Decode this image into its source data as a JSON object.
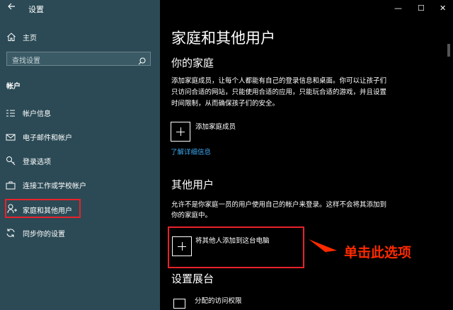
{
  "window": {
    "back_icon": "back-arrow-icon",
    "title": "设置",
    "controls": {
      "minimize": "—",
      "maximize": "☐",
      "close": "✕"
    }
  },
  "sidebar": {
    "home_label": "主页",
    "search_placeholder": "查找设置",
    "section_title": "帐户",
    "items": [
      {
        "label": "帐户信息",
        "icon": "account-info-icon"
      },
      {
        "label": "电子邮件和帐户",
        "icon": "mail-icon"
      },
      {
        "label": "登录选项",
        "icon": "key-icon"
      },
      {
        "label": "连接工作或学校帐户",
        "icon": "briefcase-icon"
      },
      {
        "label": "家庭和其他用户",
        "icon": "family-icon",
        "selected": true
      },
      {
        "label": "同步你的设置",
        "icon": "sync-icon"
      }
    ]
  },
  "main": {
    "page_title": "家庭和其他用户",
    "family": {
      "heading": "你的家庭",
      "desc_line1": "添加家庭成员，让每个人都能有自己的登录信息和桌面。你可以让孩子们",
      "desc_line2": "只访问合适的网站，只能使用合适的应用，只能玩合适的游戏，并且设置",
      "desc_line3": "时间限制，从而确保孩子们的安全。",
      "add_label": "添加家庭成员",
      "learn_more": "了解详细信息"
    },
    "others": {
      "heading": "其他用户",
      "desc_line1": "允许不是你家庭一员的用户使用自己的帐户来登录。这样不会将其添加到",
      "desc_line2": "你的家庭中。",
      "add_label": "将其他人添加到这台电脑"
    },
    "kiosk": {
      "heading": "设置展台",
      "assigned_access": "分配的访问权限"
    }
  },
  "annotation": {
    "text": "单击此选项",
    "color": "#ff2a00"
  },
  "colors": {
    "sidebar_bg": "#2b4a55",
    "main_bg": "#000000",
    "accent_link": "#3ea8f0",
    "highlight_red": "#e8222b"
  }
}
